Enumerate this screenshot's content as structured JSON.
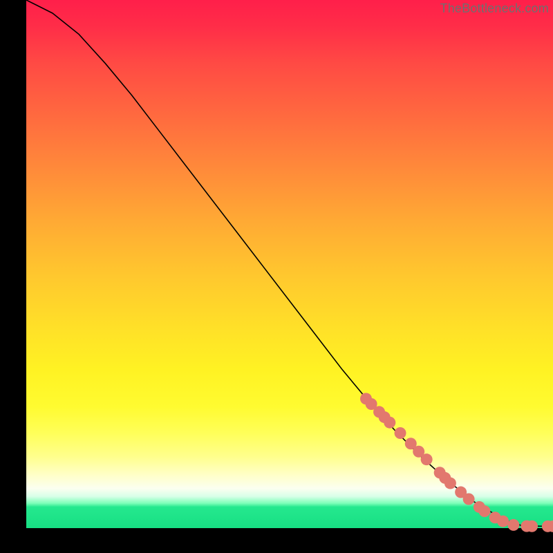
{
  "attribution": "TheBottleneck.com",
  "colors": {
    "marker": "#e2786e",
    "line": "#000000"
  },
  "chart_data": {
    "type": "line",
    "title": "",
    "xlabel": "",
    "ylabel": "",
    "xlim": [
      0,
      100
    ],
    "ylim": [
      0,
      100
    ],
    "grid": false,
    "legend": false,
    "series": [
      {
        "name": "curve",
        "x": [
          0,
          2,
          5,
          10,
          15,
          20,
          25,
          30,
          35,
          40,
          45,
          50,
          55,
          60,
          65,
          70,
          75,
          80,
          85,
          88,
          90,
          92,
          94,
          96,
          98,
          100
        ],
        "y": [
          100,
          99,
          97.5,
          93.5,
          88,
          82,
          75.5,
          69,
          62.5,
          56,
          49.5,
          43,
          36.5,
          30,
          24,
          18.5,
          13.5,
          9,
          5,
          3.2,
          2.0,
          1.1,
          0.5,
          0.4,
          0.36,
          0.35
        ]
      }
    ],
    "markers": [
      {
        "x": 64.5,
        "y": 24.5
      },
      {
        "x": 65.5,
        "y": 23.5
      },
      {
        "x": 67.0,
        "y": 22.0
      },
      {
        "x": 68.0,
        "y": 21.0
      },
      {
        "x": 69.0,
        "y": 20.0
      },
      {
        "x": 71.0,
        "y": 18.0
      },
      {
        "x": 73.0,
        "y": 16.0
      },
      {
        "x": 74.5,
        "y": 14.5
      },
      {
        "x": 76.0,
        "y": 13.0
      },
      {
        "x": 78.5,
        "y": 10.5
      },
      {
        "x": 79.5,
        "y": 9.5
      },
      {
        "x": 80.5,
        "y": 8.5
      },
      {
        "x": 82.5,
        "y": 6.8
      },
      {
        "x": 84.0,
        "y": 5.5
      },
      {
        "x": 86.0,
        "y": 4.0
      },
      {
        "x": 87.0,
        "y": 3.2
      },
      {
        "x": 89.0,
        "y": 2.0
      },
      {
        "x": 90.5,
        "y": 1.3
      },
      {
        "x": 92.5,
        "y": 0.6
      },
      {
        "x": 95.0,
        "y": 0.38
      },
      {
        "x": 96.0,
        "y": 0.36
      },
      {
        "x": 99.0,
        "y": 0.35
      },
      {
        "x": 100.0,
        "y": 0.35
      }
    ]
  }
}
